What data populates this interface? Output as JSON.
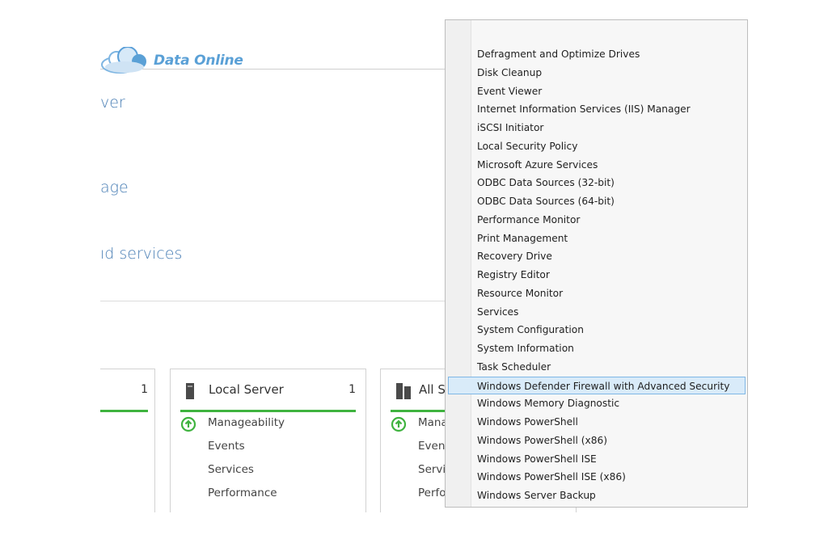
{
  "brand": {
    "logo_text": "Data Online"
  },
  "dashboard": {
    "links": [
      "ver",
      "age",
      "ıd services"
    ],
    "tiles": [
      {
        "count": "1"
      },
      {
        "title": "Local Server",
        "count": "1",
        "rows": [
          "Manageability",
          "Events",
          "Services",
          "Performance"
        ]
      },
      {
        "title": "All S",
        "rows": [
          "Mana",
          "Even",
          "Servi",
          "Perfo"
        ]
      }
    ]
  },
  "menu": {
    "items": [
      "Defragment and Optimize Drives",
      "Disk Cleanup",
      "Event Viewer",
      "Internet Information Services (IIS) Manager",
      "iSCSI Initiator",
      "Local Security Policy",
      "Microsoft Azure Services",
      "ODBC Data Sources (32-bit)",
      "ODBC Data Sources (64-bit)",
      "Performance Monitor",
      "Print Management",
      "Recovery Drive",
      "Registry Editor",
      "Resource Monitor",
      "Services",
      "System Configuration",
      "System Information",
      "Task Scheduler",
      "Windows Defender Firewall with Advanced Security",
      "Windows Memory Diagnostic",
      "Windows PowerShell",
      "Windows PowerShell (x86)",
      "Windows PowerShell ISE",
      "Windows PowerShell ISE (x86)",
      "Windows Server Backup"
    ],
    "highlighted_index": 18
  },
  "colors": {
    "accent_green": "#3fb33f",
    "highlight": "#d9ebf9",
    "link_blue": "#4a7fb5",
    "logo_blue": "#5aa0d6"
  }
}
